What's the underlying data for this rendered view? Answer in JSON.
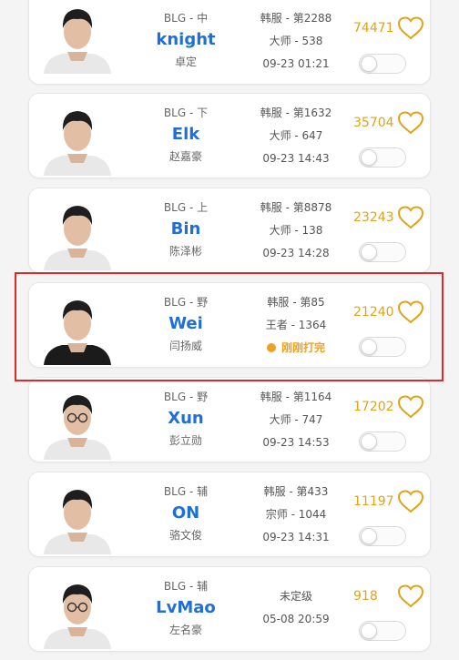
{
  "accent_color": "#e2a21a",
  "name_color": "#1f6fd6",
  "highlight_color": "#e02828",
  "players": [
    {
      "team": "BLG - 中",
      "name": "knight",
      "real_name": "卓定",
      "rank": "韩服 - 第2288",
      "tier": "大师 - 538",
      "time": "09-23 01:21",
      "likes": "74471",
      "notify_on": false,
      "avatar_icon": "player-avatar-icon"
    },
    {
      "team": "BLG - 下",
      "name": "Elk",
      "real_name": "赵嘉豪",
      "rank": "韩服 - 第1632",
      "tier": "大师 - 647",
      "time": "09-23 14:43",
      "likes": "35704",
      "notify_on": false,
      "avatar_icon": "player-avatar-icon"
    },
    {
      "team": "BLG - 上",
      "name": "Bin",
      "real_name": "陈泽彬",
      "rank": "韩服 - 第8878",
      "tier": "大师 - 138",
      "time": "09-23 14:28",
      "likes": "23243",
      "notify_on": false,
      "avatar_icon": "player-avatar-icon"
    },
    {
      "team": "BLG - 野",
      "name": "Wei",
      "real_name": "闫扬威",
      "rank": "韩服 - 第85",
      "tier": "王者 - 1364",
      "status": "刚刚打完",
      "likes": "21240",
      "notify_on": false,
      "highlighted": true,
      "avatar_icon": "player-avatar-icon"
    },
    {
      "team": "BLG - 野",
      "name": "Xun",
      "real_name": "彭立勋",
      "rank": "韩服 - 第1164",
      "tier": "大师 - 747",
      "time": "09-23 14:53",
      "likes": "17202",
      "notify_on": false,
      "avatar_icon": "player-avatar-icon"
    },
    {
      "team": "BLG - 辅",
      "name": "ON",
      "real_name": "骆文俊",
      "rank": "韩服 - 第433",
      "tier": "宗师 - 1044",
      "time": "09-23 14:31",
      "likes": "11197",
      "notify_on": false,
      "avatar_icon": "player-avatar-icon"
    },
    {
      "team": "BLG - 辅",
      "name": "LvMao",
      "real_name": "左名豪",
      "rank": "",
      "tier": "未定级",
      "time": "05-08 20:59",
      "likes": "918",
      "notify_on": false,
      "avatar_icon": "player-avatar-icon"
    }
  ]
}
